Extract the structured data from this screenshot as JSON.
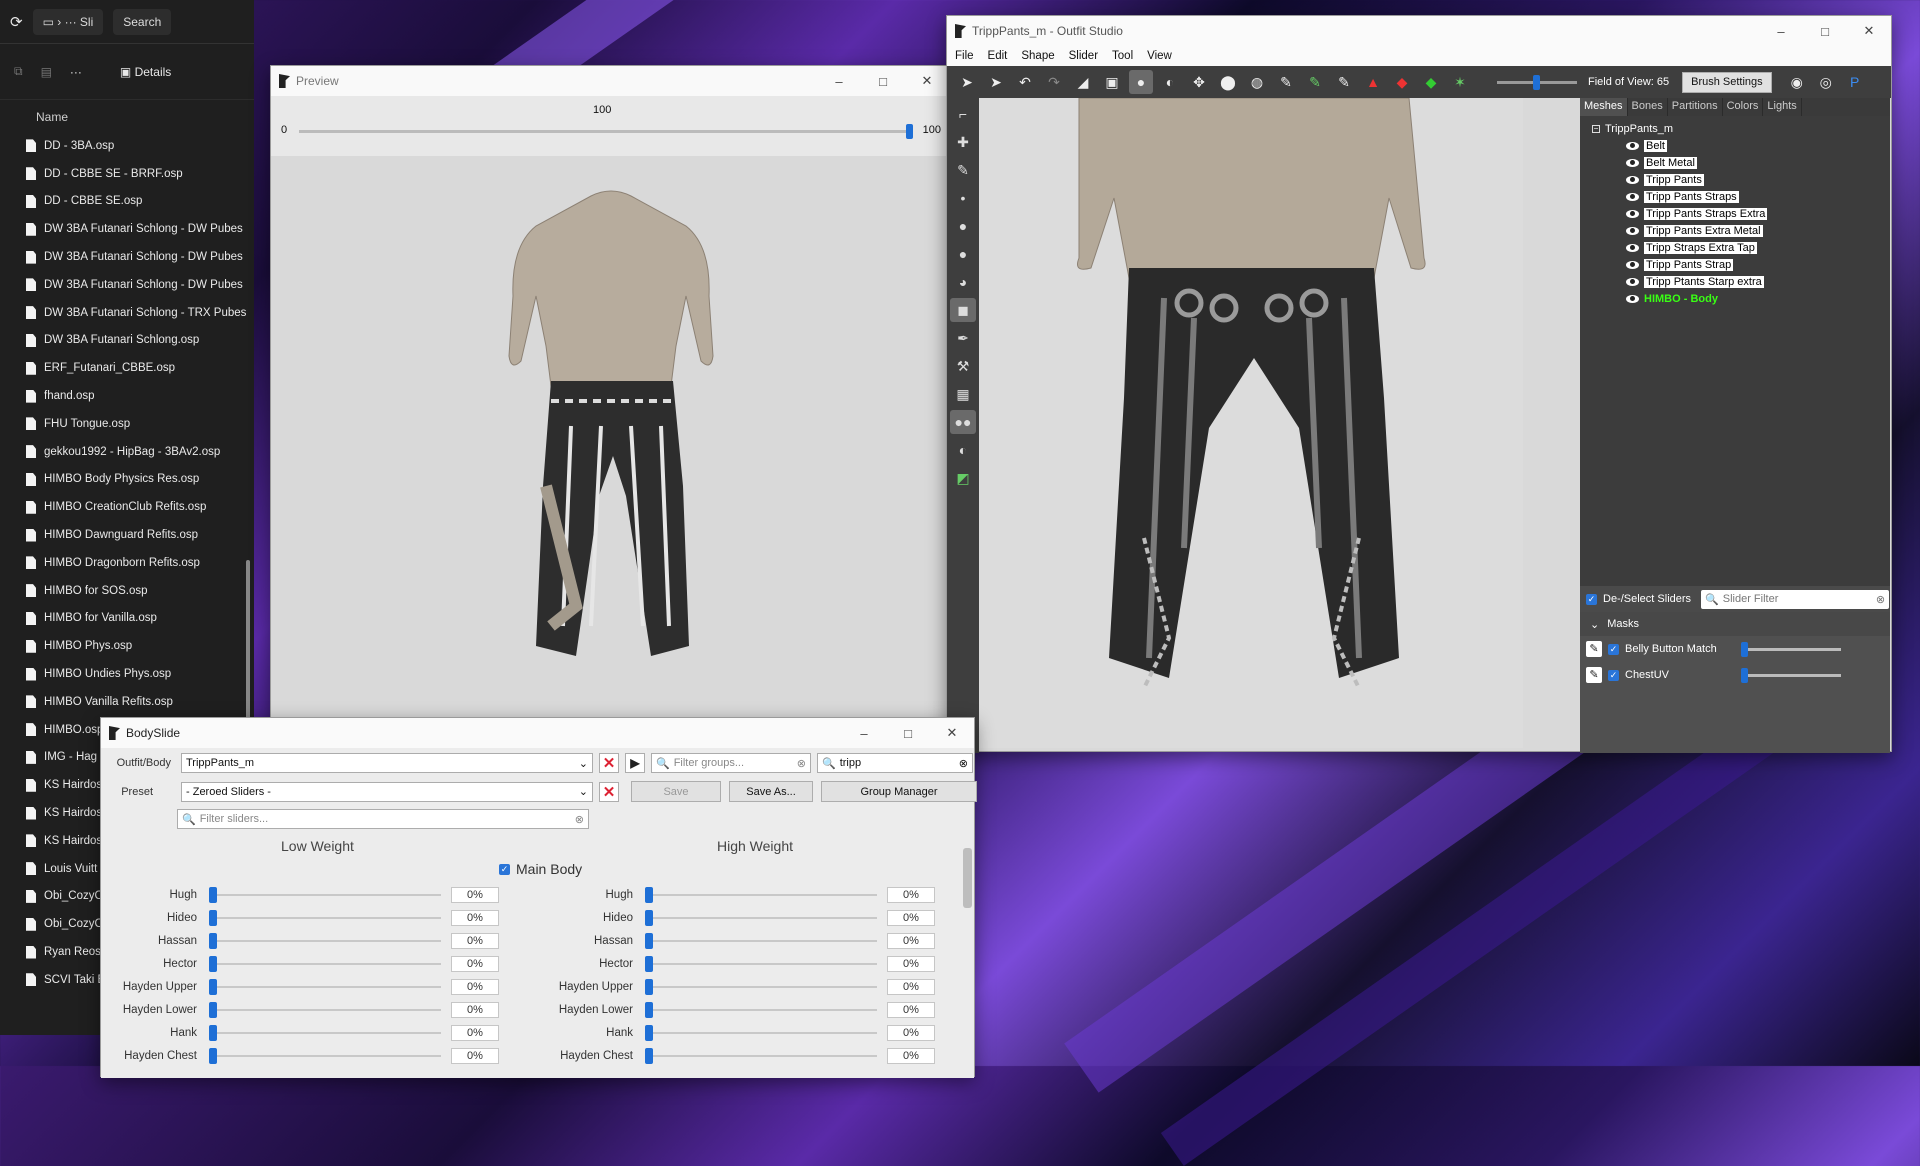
{
  "explorer": {
    "breadcrumb": "Sli",
    "search_label": "Search",
    "details_label": "Details",
    "column_name": "Name",
    "more": "···",
    "files": [
      "DD - 3BA.osp",
      "DD - CBBE SE - BRRF.osp",
      "DD - CBBE SE.osp",
      "DW 3BA Futanari Schlong - DW Pubes",
      "DW 3BA Futanari Schlong - DW Pubes",
      "DW 3BA Futanari Schlong - DW Pubes",
      "DW 3BA Futanari Schlong - TRX Pubes",
      "DW 3BA Futanari Schlong.osp",
      "ERF_Futanari_CBBE.osp",
      "fhand.osp",
      "FHU Tongue.osp",
      "gekkou1992 - HipBag - 3BAv2.osp",
      "HIMBO Body Physics Res.osp",
      "HIMBO CreationClub Refits.osp",
      "HIMBO Dawnguard Refits.osp",
      "HIMBO Dragonborn Refits.osp",
      "HIMBO for SOS.osp",
      "HIMBO for Vanilla.osp",
      "HIMBO Phys.osp",
      "HIMBO Undies Phys.osp",
      "HIMBO Vanilla Refits.osp",
      "HIMBO.osp",
      "IMG - Hag",
      "KS Hairdos",
      "KS Hairdos",
      "KS Hairdos",
      "Louis Vuitt",
      "Obi_CozyCl",
      "Obi_CozyCl",
      "Ryan Reos",
      "SCVI Taki B"
    ]
  },
  "preview": {
    "title": "Preview",
    "slider_min": "0",
    "slider_max": "100",
    "slider_value": "100",
    "slider_level": 1.0
  },
  "outfit_studio": {
    "title": "TrippPants_m - Outfit Studio",
    "menu": [
      "File",
      "Edit",
      "Shape",
      "Slider",
      "Tool",
      "View"
    ],
    "fov_label": "Field of View: 65",
    "brush_settings": "Brush Settings",
    "tabs": [
      "Meshes",
      "Bones",
      "Partitions",
      "Colors",
      "Lights"
    ],
    "tree_root": "TrippPants_m",
    "meshes": [
      "Belt",
      "Belt Metal",
      "Tripp Pants",
      "Tripp Pants Straps",
      "Tripp Pants Straps Extra",
      "Tripp Pants Extra Metal",
      "Tripp Straps Extra Tap",
      "Tripp Pants Strap",
      "Tripp Ptants Starp extra",
      "HIMBO - Body"
    ],
    "highlight_color": "#39ff14",
    "deselect_label": "De-/Select Sliders",
    "slider_filter_placeholder": "Slider Filter",
    "masks_label": "Masks",
    "mask_rows": [
      "Belly Button Match",
      "ChestUV"
    ]
  },
  "bodyslide": {
    "title": "BodySlide",
    "outfit_label": "Outfit/Body",
    "outfit_value": "TrippPants_m",
    "filter_groups_placeholder": "Filter groups...",
    "filter_outfit_value": "tripp",
    "preset_label": "Preset",
    "preset_value": "- Zeroed Sliders -",
    "save": "Save",
    "save_as": "Save As...",
    "group_manager": "Group Manager",
    "filter_sliders_placeholder": "Filter sliders...",
    "low_weight": "Low Weight",
    "high_weight": "High Weight",
    "category": "Main Body",
    "sliders": [
      {
        "name": "Hugh",
        "low": "0%",
        "high": "0%"
      },
      {
        "name": "Hideo",
        "low": "0%",
        "high": "0%"
      },
      {
        "name": "Hassan",
        "low": "0%",
        "high": "0%"
      },
      {
        "name": "Hector",
        "low": "0%",
        "high": "0%"
      },
      {
        "name": "Hayden Upper",
        "low": "0%",
        "high": "0%"
      },
      {
        "name": "Hayden Lower",
        "low": "0%",
        "high": "0%"
      },
      {
        "name": "Hank",
        "low": "0%",
        "high": "0%"
      },
      {
        "name": "Hayden Chest",
        "low": "0%",
        "high": "0%"
      }
    ]
  }
}
